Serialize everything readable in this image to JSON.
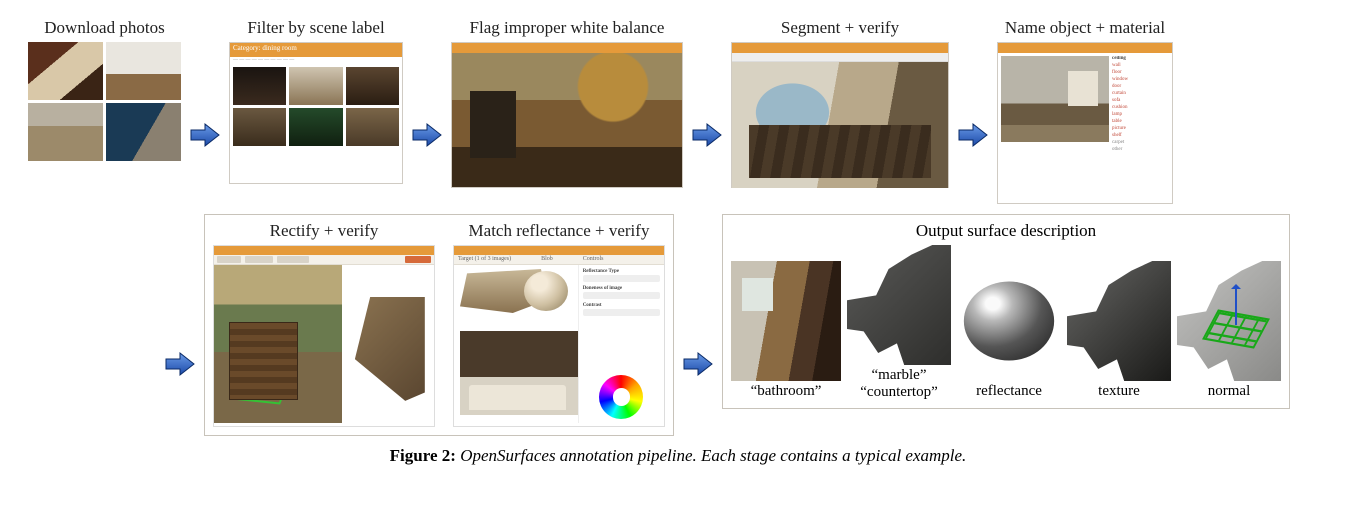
{
  "stages": {
    "download": "Download photos",
    "filter": "Filter by scene label",
    "whitebalance": "Flag improper white balance",
    "segment": "Segment + verify",
    "name": "Name object + material",
    "rectify": "Rectify + verify",
    "match": "Match reflectance + verify",
    "output": "Output surface description"
  },
  "filter_header": "Category: dining room",
  "match_cols": {
    "target": "Target (1 of 3 images)",
    "blob": "Blob",
    "controls": "Controls"
  },
  "match_ctrl": {
    "rt": "Reflectance Type",
    "di": "Doneness of image",
    "ct": "Contrast"
  },
  "name_list": [
    "ceiling",
    "wall",
    "floor",
    "window",
    "door",
    "curtain",
    "sofa",
    "cushion",
    "lamp",
    "table",
    "picture",
    "shelf",
    "carpet",
    "other"
  ],
  "output": {
    "bathroom": "“bathroom”",
    "marble_l1": "“marble”",
    "marble_l2": "“countertop”",
    "reflectance": "reflectance",
    "texture": "texture",
    "normal": "normal"
  },
  "caption": {
    "fig": "Figure 2:",
    "text": "OpenSurfaces annotation pipeline. Each stage contains a typical example."
  }
}
